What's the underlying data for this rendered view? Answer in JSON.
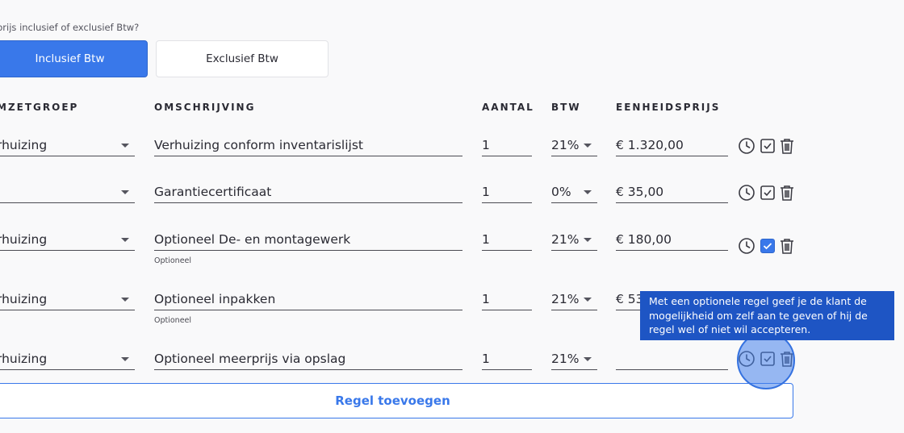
{
  "header": {
    "question": "prijs inclusief of exclusief Btw?",
    "btn_inclusive": "Inclusief Btw",
    "btn_exclusive": "Exclusief Btw"
  },
  "columns": {
    "omzetgroep": "MZETGROEP",
    "omschrijving": "OMSCHRIJVING",
    "aantal": "AANTAL",
    "btw": "BTW",
    "eenheidsprijs": "EENHEIDSPRIJS"
  },
  "rows": [
    {
      "group": "rhuizing",
      "description": "Verhuizing conform inventarislijst",
      "note": "",
      "quantity": "1",
      "vat": "21%",
      "price": "€ 1.320,00",
      "optional_checked": false
    },
    {
      "group": "",
      "description": "Garantiecertificaat",
      "note": "",
      "quantity": "1",
      "vat": "0%",
      "price": "€ 35,00",
      "optional_checked": false
    },
    {
      "group": "rhuizing",
      "description": "Optioneel De- en montagewerk",
      "note": "Optioneel",
      "quantity": "1",
      "vat": "21%",
      "price": "€ 180,00",
      "optional_checked": true
    },
    {
      "group": "rhuizing",
      "description": "Optioneel inpakken",
      "note": "Optioneel",
      "quantity": "1",
      "vat": "21%",
      "price": "€ 53",
      "optional_checked": false
    },
    {
      "group": "rhuizing",
      "description": "Optioneel meerprijs via opslag",
      "note": "",
      "quantity": "1",
      "vat": "21%",
      "price": "",
      "optional_checked": false
    }
  ],
  "add_row_label": "Regel toevoegen",
  "tooltip": {
    "line1": "Met een optionele regel geef je de klant de",
    "line2": "mogelijkheid om zelf aan te geven of hij de",
    "line3": "regel wel of niet wil accepteren."
  },
  "icons": {
    "time": "clock-icon",
    "optional": "checkbox-icon",
    "delete": "trash-icon"
  },
  "colors": {
    "accent": "#3978ea",
    "tooltip_bg": "#1e55c4"
  }
}
